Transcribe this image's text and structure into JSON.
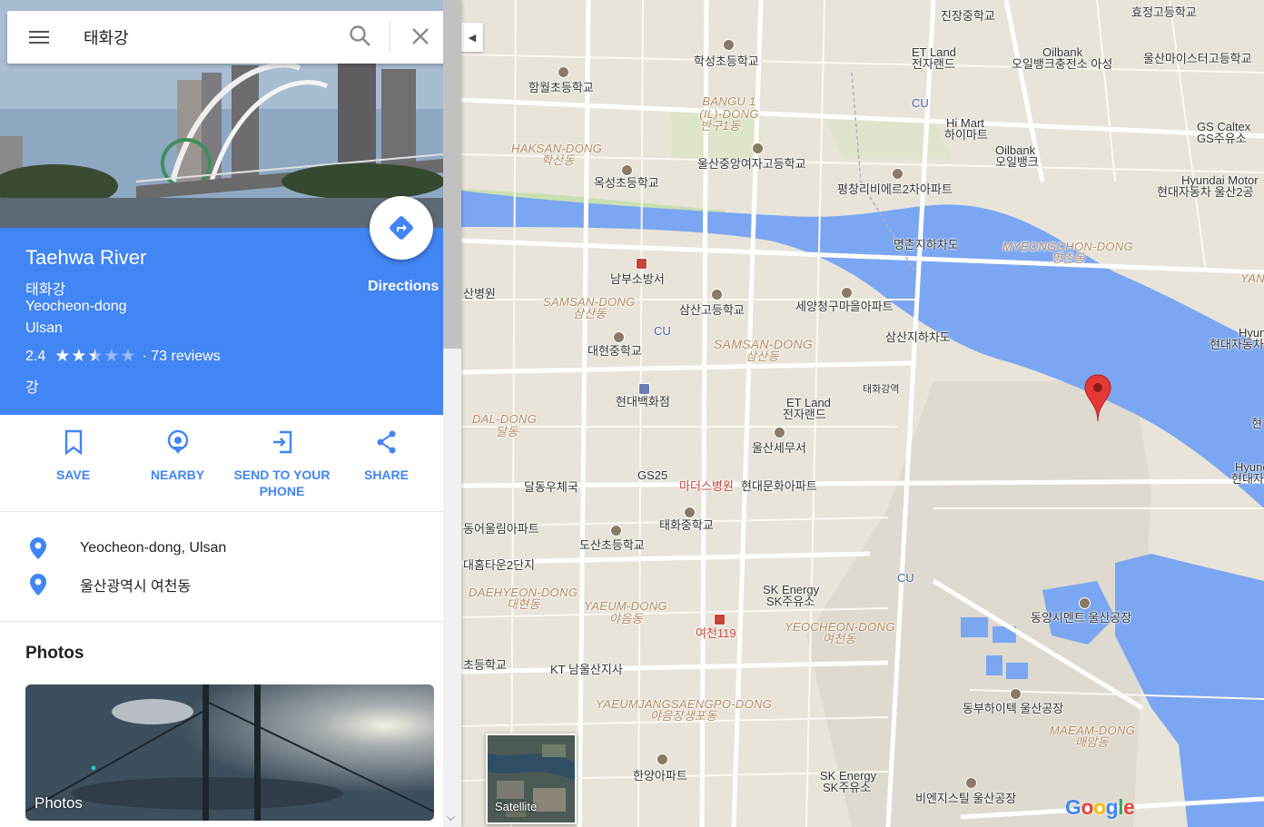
{
  "search": {
    "value": "태화강"
  },
  "place": {
    "title": "Taehwa River",
    "native_name": "태화강",
    "district": "Yeocheon-dong",
    "city": "Ulsan",
    "rating": "2.4",
    "stars_filled": 2.4,
    "reviews": "· 73 reviews",
    "category": "강"
  },
  "directions": {
    "label": "Directions"
  },
  "actions": {
    "save": "SAVE",
    "nearby": "NEARBY",
    "send_line1": "SEND TO YOUR",
    "send_line2": "PHONE",
    "share": "SHARE"
  },
  "address": {
    "english": "Yeocheon-dong, Ulsan",
    "korean": "울산광역시 여천동"
  },
  "photos": {
    "heading": "Photos",
    "card_label": "Photos"
  },
  "map": {
    "satellite_label": "Satellite",
    "logo": "Google",
    "labels": [
      "진장중학교",
      "효정고등학교",
      "학성초등학교",
      "ET Land",
      "전자랜드",
      "Oilbank",
      "오일뱅크충전소 아성",
      "울산마이스터고등학교",
      "함월초등학교",
      "BANGU 1 (IL)-DONG",
      "반구1동",
      "CU",
      "Hi Mart",
      "하이마트",
      "GS Caltex",
      "GS주유소",
      "HAKSAN-DONG",
      "학산동",
      "울산중앙여자고등학교",
      "Oilbank",
      "오일뱅크",
      "옥성초등학교",
      "평창리비에르2차아파트",
      "Hyundai Motor",
      "현대자동차 울산2공",
      "명촌지하차도",
      "MYEONGCHON-DONG",
      "명촌동",
      "남부소방서",
      "산병원",
      "SAMSAN-DONG",
      "삼산동",
      "삼산고등학교",
      "세양청구마을아파트",
      "CU",
      "SAMSAN-DONG",
      "삼산동",
      "삼산지하차도",
      "대현중학교",
      "태화강역",
      "현대백화점",
      "ET Land",
      "전자랜드",
      "DAL-DONG",
      "달동",
      "울산세무서",
      "GS25",
      "마더스병원",
      "현대문화아파트",
      "달동우체국",
      "태화중학교",
      "도산초등학교",
      "동어울림아파트",
      "대홈타운2단지",
      "DAEHYEON-DONG",
      "대현동",
      "YAEUM-DONG",
      "야음동",
      "여천119",
      "SK Energy",
      "SK주유소",
      "YEOCHEON-DONG",
      "여천동",
      "CU",
      "동양시멘트 울산공장",
      "초등학교",
      "KT 남울산지사",
      "YAEUMJANGSAENGPO-DONG",
      "야음장생포동",
      "동부하이텍 울산공장",
      "MAEAM-DONG",
      "매암동",
      "한양아파트",
      "SK Energy",
      "SK주유소",
      "비엔지스틸 울산공장",
      "Hyund",
      "현대자동",
      "YAN",
      "Hyunda",
      "현대자동차",
      "현"
    ]
  }
}
